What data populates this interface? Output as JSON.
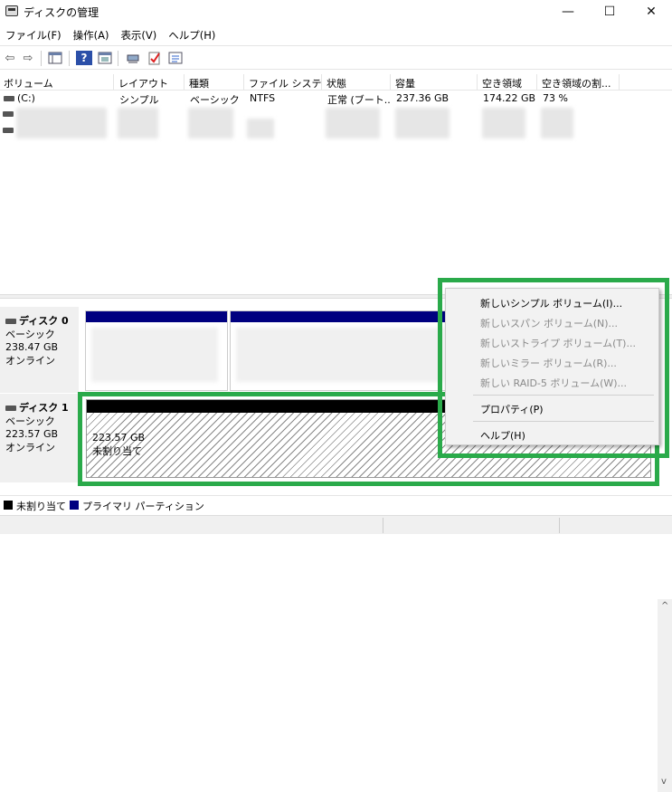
{
  "window": {
    "title": "ディスクの管理",
    "minimize_glyph": "—",
    "maximize_glyph": "☐",
    "close_glyph": "✕"
  },
  "menu": [
    "ファイル(F)",
    "操作(A)",
    "表示(V)",
    "ヘルプ(H)"
  ],
  "toolbar": {
    "icons": [
      "back-arrow-icon",
      "forward-arrow-icon",
      "console-tree-icon",
      "help-icon",
      "help-topics-icon",
      "connect-drive-icon",
      "check-icon",
      "properties-icon"
    ],
    "back_glyph": "⇦",
    "forward_glyph": "⇨",
    "help_glyph": "?"
  },
  "volume_table": {
    "columns": [
      "ボリューム",
      "レイアウト",
      "種類",
      "ファイル システム",
      "状態",
      "容量",
      "空き領域",
      "空き領域の割..."
    ],
    "rows": [
      {
        "volume": "(C:)",
        "layout": "シンプル",
        "type": "ベーシック",
        "fs": "NTFS",
        "status": "正常 (ブート...",
        "capacity": "237.36 GB",
        "free": "174.22 GB",
        "percent": "73 %"
      }
    ]
  },
  "disks": [
    {
      "name": "ディスク 0",
      "type": "ベーシック",
      "size": "238.47 GB",
      "state": "オンライン"
    },
    {
      "name": "ディスク 1",
      "type": "ベーシック",
      "size": "223.57 GB",
      "state": "オンライン",
      "partition": {
        "size": "223.57 GB",
        "label": "未割り当て"
      }
    }
  ],
  "legend": [
    {
      "label": "未割り当て",
      "color": "#000000"
    },
    {
      "label": "プライマリ パーティション",
      "color": "#000080"
    }
  ],
  "context_menu": {
    "items": [
      {
        "label": "新しいシンプル ボリューム(I)...",
        "enabled": true
      },
      {
        "label": "新しいスパン ボリューム(N)...",
        "enabled": false
      },
      {
        "label": "新しいストライプ ボリューム(T)...",
        "enabled": false
      },
      {
        "label": "新しいミラー ボリューム(R)...",
        "enabled": false
      },
      {
        "label": "新しい RAID-5 ボリューム(W)...",
        "enabled": false
      },
      {
        "label": "プロパティ(P)",
        "enabled": true
      },
      {
        "label": "ヘルプ(H)",
        "enabled": true
      }
    ]
  },
  "colors": {
    "highlight": "#2aaa4a",
    "primary_partition": "#000080",
    "unallocated": "#000000",
    "disabled_text": "#8a8a8a"
  },
  "scroll": {
    "up_glyph": "^",
    "down_glyph": "v"
  }
}
